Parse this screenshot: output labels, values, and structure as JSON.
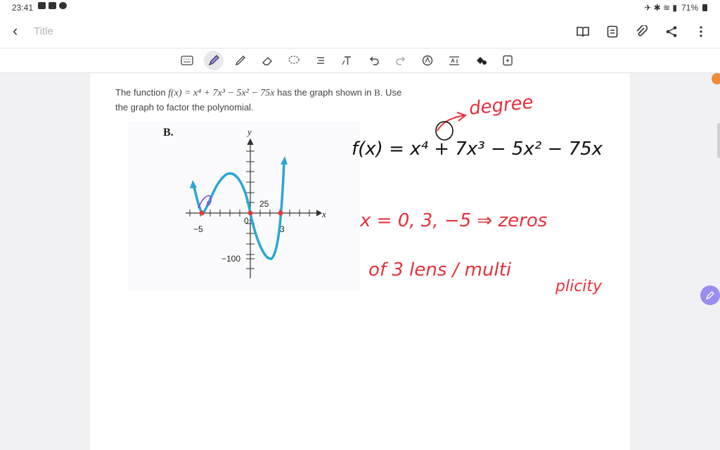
{
  "status": {
    "time": "23:41",
    "battery": "71%"
  },
  "appbar": {
    "back_glyph": "‹",
    "title": "Title"
  },
  "toolbar": {
    "icons": [
      "keyboard-icon",
      "pen-icon",
      "highlighter-icon",
      "eraser-icon",
      "lasso-icon",
      "text-format-icon",
      "text-icon",
      "undo-icon",
      "redo-icon",
      "shape-icon",
      "ruler-text-icon",
      "color-icon",
      "add-page-icon"
    ],
    "active": "pen-icon"
  },
  "problem": {
    "line1_pre": "The function ",
    "function_math": "f(x) = x⁴ + 7x³ − 5x² − 75x",
    "line1_post": " has the graph shown in ",
    "graph_ref": "B",
    "line1_end": ". Use",
    "line2": "the graph to factor the polynomial."
  },
  "graph": {
    "label": "B.",
    "x_axis": "x",
    "y_axis": "y",
    "tick_neg5": "−5",
    "tick_0": "0",
    "tick_3": "3",
    "tick_25": "25",
    "tick_neg100": "−100",
    "curve_color": "#2aa6d6",
    "zero_color": "#e23b3b"
  },
  "handwriting": {
    "degree": "degree",
    "line1": "f(x) = x⁴ + 7x³ − 5x² − 75x",
    "line2": "x = 0, 3, −5  ⇒ zeros",
    "line3": "of 3 lens / multi",
    "line3b": "plicity",
    "ink_color": "#e8303a"
  },
  "colors": {
    "accent": "#9a8cf0",
    "orange": "#ef8a3c"
  }
}
